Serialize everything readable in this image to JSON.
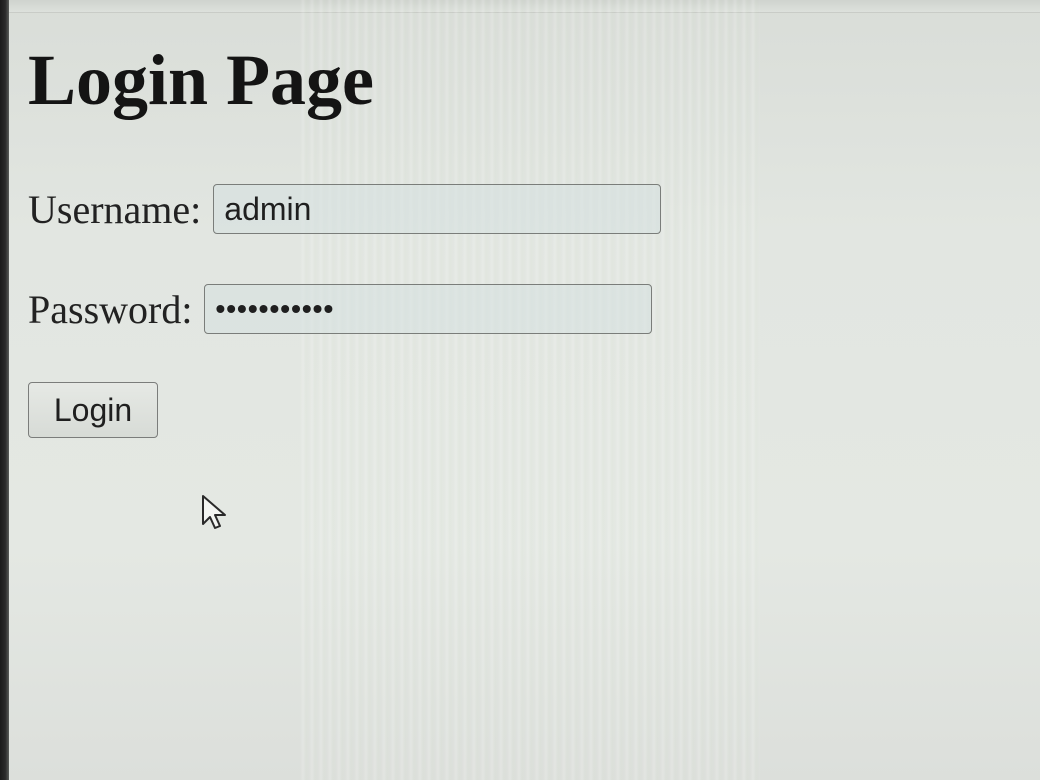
{
  "page": {
    "title": "Login Page"
  },
  "form": {
    "username": {
      "label": "Username:",
      "value": "admin"
    },
    "password": {
      "label": "Password:",
      "masked_value": "•••••••••••"
    },
    "submit_label": "Login"
  },
  "cursor": {
    "icon": "arrow-pointer-icon"
  }
}
